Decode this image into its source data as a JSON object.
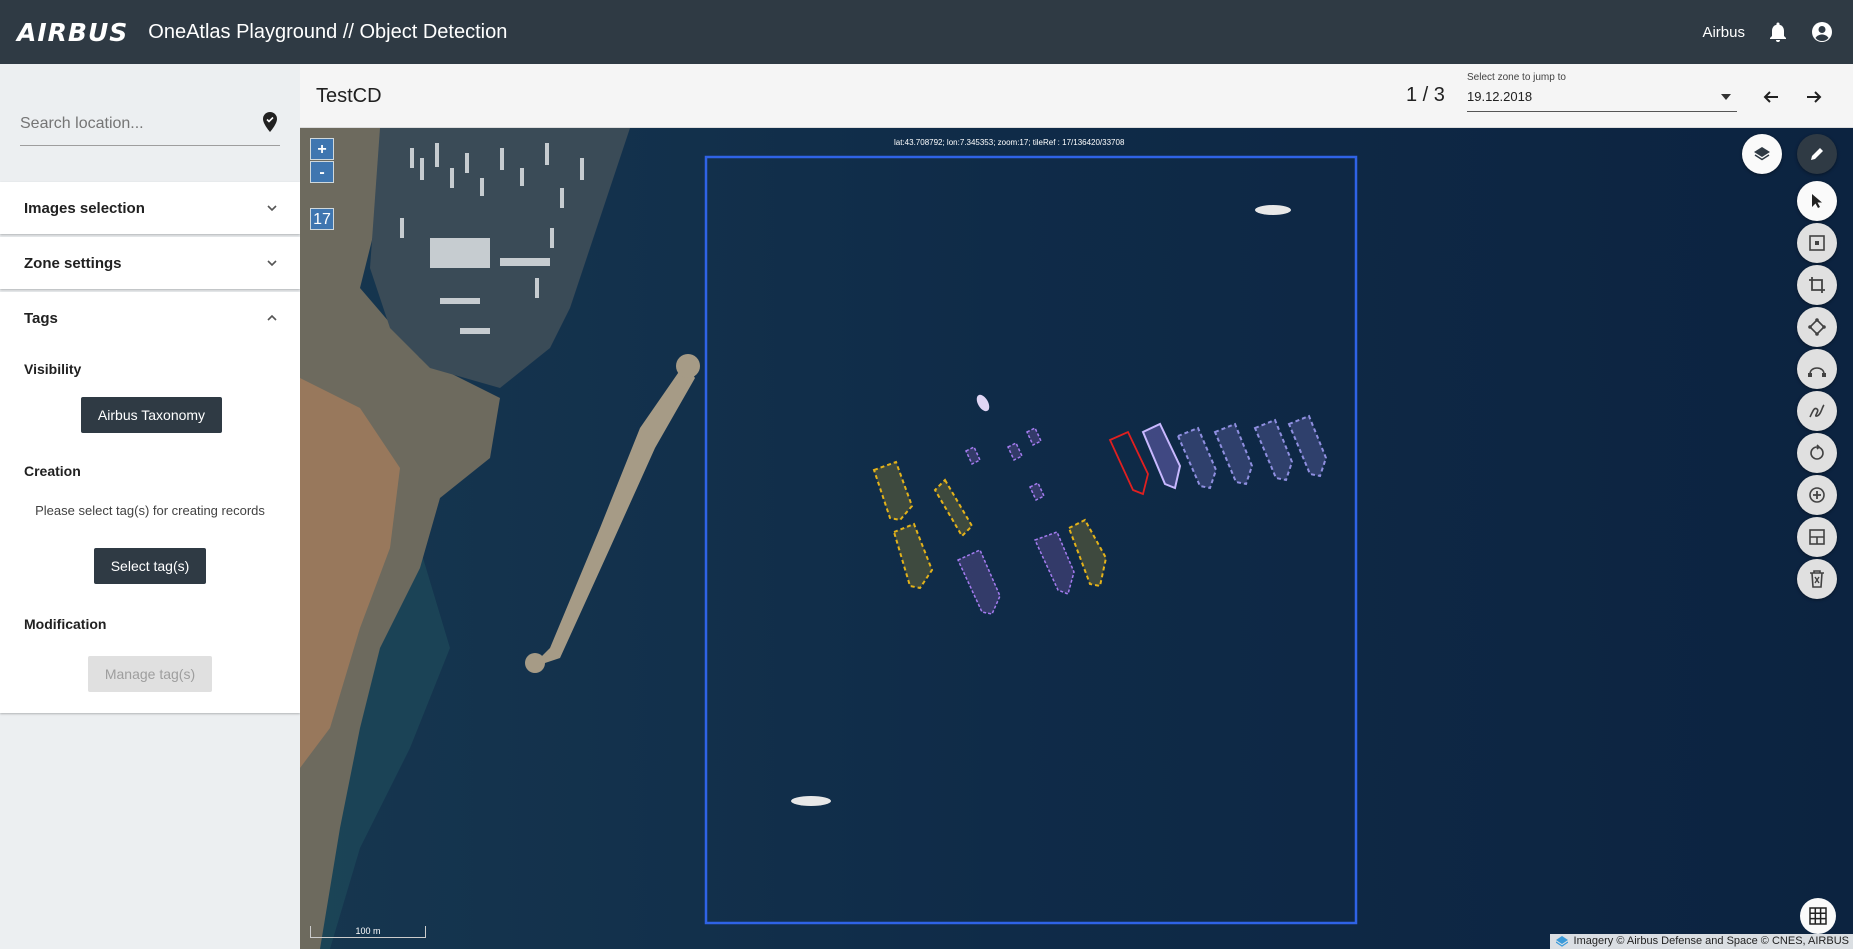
{
  "topbar": {
    "logo": "AIRBUS",
    "title": "OneAtlas Playground // Object Detection",
    "user": "Airbus",
    "icons": [
      "bell-icon",
      "account-icon"
    ]
  },
  "sidebar": {
    "search": {
      "placeholder": "Search location...",
      "value": ""
    },
    "panels": {
      "images": "Images selection",
      "zone": "Zone settings",
      "tags": "Tags"
    },
    "tags": {
      "visibility_label": "Visibility",
      "taxonomy_button": "Airbus Taxonomy",
      "creation_label": "Creation",
      "creation_info": "Please select tag(s) for creating records",
      "select_button": "Select tag(s)",
      "modification_label": "Modification",
      "manage_button": "Manage tag(s)"
    }
  },
  "header": {
    "zone_name": "TestCD",
    "pager": "1 / 3",
    "zone_select_label": "Select zone to jump to",
    "zone_select_value": "19.12.2018"
  },
  "map": {
    "zoom_in": "+",
    "zoom_out": "-",
    "zoom_level": "17",
    "coords": "lat:43.708792; lon:7.345353; zoom:17; tileRef : 17/136420/33708",
    "scale": "100 m",
    "attribution": "Imagery © Airbus Defense and Space © CNES, AIRBUS",
    "tools": [
      "layers-icon",
      "edit-icon",
      "cursor-icon",
      "point-icon",
      "bbox-icon",
      "polygon-icon",
      "curve-icon",
      "freehand-icon",
      "rotate-icon",
      "add-icon",
      "cut-icon",
      "delete-icon",
      "grid-icon"
    ],
    "colors": {
      "zone_border": "#2f63e6",
      "tag_yellow": "#e3b21a",
      "tag_purple": "#a47cf0",
      "tag_red": "#e02020",
      "tag_lavender": "#8f8fe0"
    }
  }
}
